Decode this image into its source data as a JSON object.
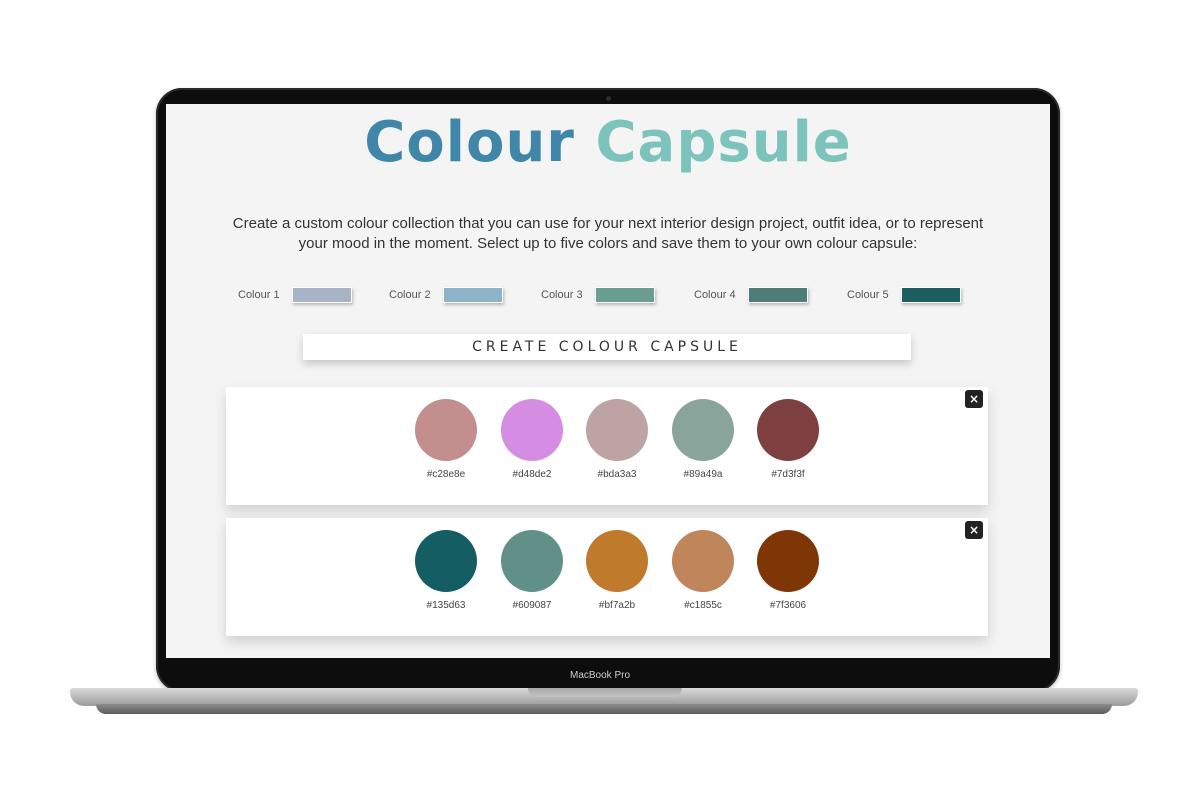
{
  "device": {
    "label": "MacBook Pro"
  },
  "app": {
    "title_part1": "Colour",
    "title_part2": "Capsule",
    "description": "Create a custom colour collection that you can use for your next interior design project, outfit idea, or to represent your mood in the moment. Select up to five colors and save them to your own colour capsule:",
    "title_colors": [
      "#3f86a8",
      "#7cc4bb"
    ]
  },
  "pickers": [
    {
      "label": "Colour 1",
      "color": "#a6b4c6"
    },
    {
      "label": "Colour 2",
      "color": "#8db3c9"
    },
    {
      "label": "Colour 3",
      "color": "#6a9e8e"
    },
    {
      "label": "Colour 4",
      "color": "#4d7d76"
    },
    {
      "label": "Colour 5",
      "color": "#1d5e60"
    }
  ],
  "create_button_label": "CREATE COLOUR CAPSULE",
  "capsules": [
    {
      "close_label": "×",
      "colors": [
        {
          "hex": "#c28e8e"
        },
        {
          "hex": "#d48de2"
        },
        {
          "hex": "#bda3a3"
        },
        {
          "hex": "#89a49a"
        },
        {
          "hex": "#7d3f3f"
        }
      ]
    },
    {
      "close_label": "×",
      "colors": [
        {
          "hex": "#135d63"
        },
        {
          "hex": "#609087"
        },
        {
          "hex": "#bf7a2b"
        },
        {
          "hex": "#c1855c"
        },
        {
          "hex": "#7f3606"
        }
      ]
    }
  ]
}
